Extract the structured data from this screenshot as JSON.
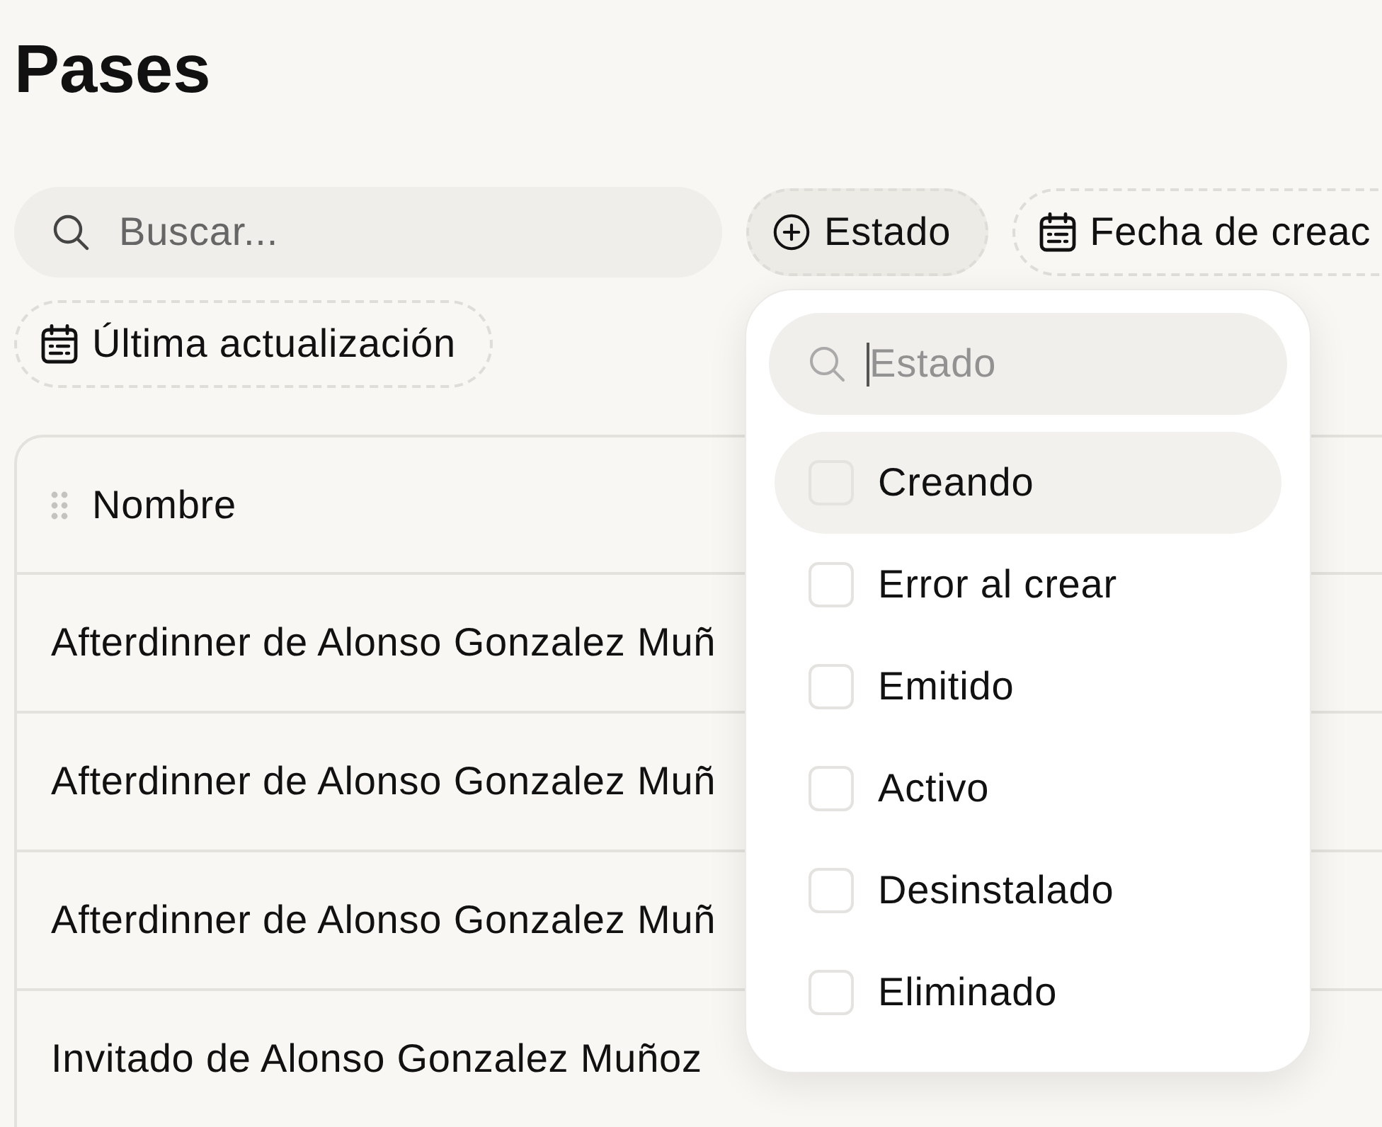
{
  "page": {
    "title": "Pases"
  },
  "toolbar": {
    "search": {
      "placeholder": "Buscar..."
    },
    "filters": [
      {
        "kind": "add",
        "label": "Estado",
        "open": true
      },
      {
        "kind": "date",
        "label": "Fecha de creac",
        "open": false
      },
      {
        "kind": "date",
        "label": "Última actualización",
        "open": false
      }
    ]
  },
  "status_menu": {
    "search": {
      "placeholder": "Estado",
      "focused": true
    },
    "options": [
      {
        "label": "Creando",
        "checked": false,
        "highlighted": true
      },
      {
        "label": "Error al crear",
        "checked": false,
        "highlighted": false
      },
      {
        "label": "Emitido",
        "checked": false,
        "highlighted": false
      },
      {
        "label": "Activo",
        "checked": false,
        "highlighted": false
      },
      {
        "label": "Desinstalado",
        "checked": false,
        "highlighted": false
      },
      {
        "label": "Eliminado",
        "checked": false,
        "highlighted": false
      }
    ]
  },
  "table": {
    "columns": [
      {
        "label": "Nombre"
      }
    ],
    "rows": [
      {
        "cells": [
          "Afterdinner de Alonso Gonzalez Muñ"
        ]
      },
      {
        "cells": [
          "Afterdinner de Alonso Gonzalez Muñ"
        ]
      },
      {
        "cells": [
          "Afterdinner de Alonso Gonzalez Muñ"
        ]
      },
      {
        "cells": [
          "Invitado de Alonso Gonzalez Muñoz"
        ]
      }
    ]
  }
}
